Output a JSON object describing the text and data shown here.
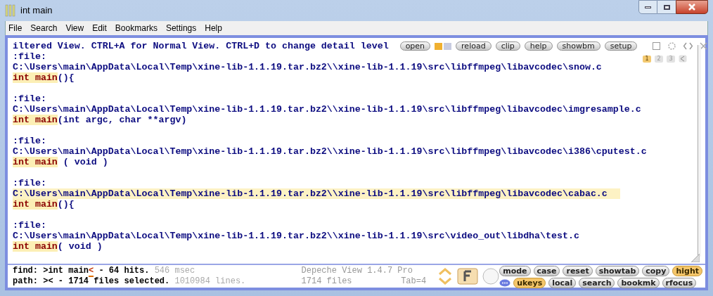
{
  "window": {
    "title": "int main"
  },
  "menu": [
    "File",
    "Search",
    "View",
    "Edit",
    "Bookmarks",
    "Settings",
    "Help"
  ],
  "view": {
    "header": "iltered View. CTRL+A for Normal View. CTRL+D to change detail level",
    "toolbar": [
      {
        "kind": "button",
        "label": "open"
      },
      {
        "kind": "icon"
      },
      {
        "kind": "button",
        "label": "reload"
      },
      {
        "kind": "button",
        "label": "clip"
      },
      {
        "kind": "button",
        "label": "help"
      },
      {
        "kind": "button",
        "label": "showbm"
      },
      {
        "kind": "button",
        "label": "setup"
      }
    ],
    "pages": [
      {
        "label": "1",
        "selected": true
      },
      {
        "label": "2",
        "selected": false
      },
      {
        "label": "3",
        "selected": false
      }
    ],
    "results": [
      {
        "file_label": ":file:",
        "path": "C:\\Users\\main\\AppData\\Local\\Temp\\xine-lib-1.1.19.tar.bz2\\\\xine-lib-1.1.19\\src\\libffmpeg\\libavcodec\\snow.c",
        "match": "int main",
        "rest": "(){",
        "selected": false
      },
      {
        "file_label": ":file:",
        "path": "C:\\Users\\main\\AppData\\Local\\Temp\\xine-lib-1.1.19.tar.bz2\\\\xine-lib-1.1.19\\src\\libffmpeg\\libavcodec\\imgresample.c",
        "match": "int main",
        "rest": "(int argc, char **argv)",
        "selected": false
      },
      {
        "file_label": ":file:",
        "path": "C:\\Users\\main\\AppData\\Local\\Temp\\xine-lib-1.1.19.tar.bz2\\\\xine-lib-1.1.19\\src\\libffmpeg\\libavcodec\\i386\\cputest.c",
        "match": "int main",
        "rest": " ( void )",
        "selected": false
      },
      {
        "file_label": ":file:",
        "path": "C:\\Users\\main\\AppData\\Local\\Temp\\xine-lib-1.1.19.tar.bz2\\\\xine-lib-1.1.19\\src\\libffmpeg\\libavcodec\\cabac.c",
        "match": "int main",
        "rest": "(){",
        "selected": true
      },
      {
        "file_label": ":file:",
        "path": "C:\\Users\\main\\AppData\\Local\\Temp\\xine-lib-1.1.19.tar.bz2\\\\xine-lib-1.1.19\\src\\video_out\\libdha\\test.c",
        "match": "int main",
        "rest": "( void )",
        "selected": false
      }
    ]
  },
  "status": {
    "find": {
      "label": "find:",
      "query": ">int main",
      "cursor": "<",
      "summary": " - 64 hits.",
      "timing": "546 msec"
    },
    "path": {
      "label": "path:",
      "query": "><",
      "summary": " - 1714 files selected.",
      "lines": "1010984 lines."
    },
    "app": "Depeche View 1.4.7 Pro",
    "files": "1714 files",
    "tab": "Tab=4",
    "buttons_top": [
      {
        "label": "mode",
        "on": false
      },
      {
        "label": "case",
        "on": false
      },
      {
        "label": "reset",
        "on": false
      },
      {
        "label": "showtab",
        "on": false
      },
      {
        "label": "copy",
        "on": false
      },
      {
        "label": "hight",
        "on": true
      }
    ],
    "buttons_bottom": [
      {
        "label": "ukeys",
        "on": true
      },
      {
        "label": "local",
        "on": false
      },
      {
        "label": "search",
        "on": false
      },
      {
        "label": "bookmk",
        "on": false
      },
      {
        "label": "rfocus",
        "on": false
      }
    ]
  }
}
